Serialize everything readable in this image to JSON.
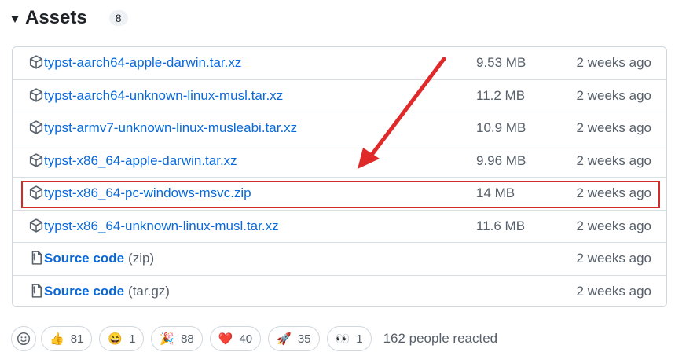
{
  "header": {
    "title": "Assets",
    "count": "8"
  },
  "assets": [
    {
      "name": "typst-aarch64-apple-darwin.tar.xz",
      "size": "9.53 MB",
      "date": "2 weeks ago",
      "icon": "package-icon"
    },
    {
      "name": "typst-aarch64-unknown-linux-musl.tar.xz",
      "size": "11.2 MB",
      "date": "2 weeks ago",
      "icon": "package-icon"
    },
    {
      "name": "typst-armv7-unknown-linux-musleabi.tar.xz",
      "size": "10.9 MB",
      "date": "2 weeks ago",
      "icon": "package-icon"
    },
    {
      "name": "typst-x86_64-apple-darwin.tar.xz",
      "size": "9.96 MB",
      "date": "2 weeks ago",
      "icon": "package-icon"
    },
    {
      "name": "typst-x86_64-pc-windows-msvc.zip",
      "size": "14 MB",
      "date": "2 weeks ago",
      "icon": "package-icon"
    },
    {
      "name": "typst-x86_64-unknown-linux-musl.tar.xz",
      "size": "11.6 MB",
      "date": "2 weeks ago",
      "icon": "package-icon"
    },
    {
      "name": "Source code",
      "ext": "(zip)",
      "size": "",
      "date": "2 weeks ago",
      "icon": "file-zip-icon"
    },
    {
      "name": "Source code",
      "ext": "(tar.gz)",
      "size": "",
      "date": "2 weeks ago",
      "icon": "file-zip-icon"
    }
  ],
  "reactions": {
    "items": [
      {
        "emoji": "👍",
        "count": "81"
      },
      {
        "emoji": "😄",
        "count": "1"
      },
      {
        "emoji": "🎉",
        "count": "88"
      },
      {
        "emoji": "❤️",
        "count": "40"
      },
      {
        "emoji": "🚀",
        "count": "35"
      },
      {
        "emoji": "👀",
        "count": "1"
      }
    ],
    "summary": "162 people reacted"
  },
  "colors": {
    "link": "#0969da",
    "muted": "#57606a",
    "highlight": "#d42a2a"
  }
}
